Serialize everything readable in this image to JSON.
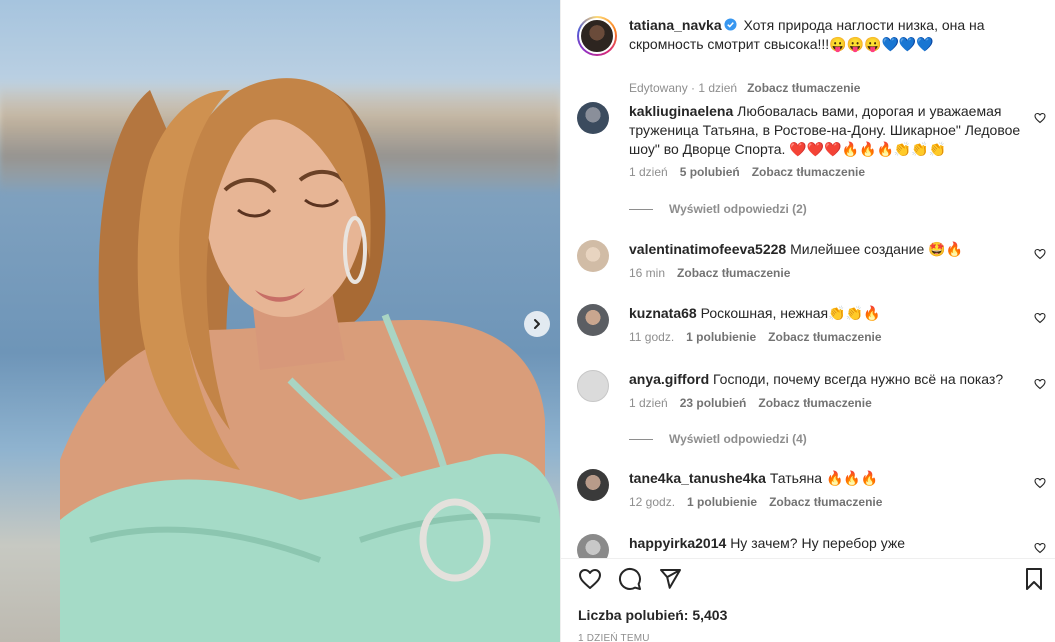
{
  "post": {
    "author": "tatiana_navka",
    "caption": "Хотя природа наглости низка, она на скромность смотрит свысока!!!😛😛😛💙💙💙",
    "edited_label": "Edytowany · 1 dzień",
    "translate_label": "Zobacz tłumaczenie"
  },
  "comments": [
    {
      "user": "kakliuginaelena",
      "text": "Любовалась вами, дорогая и уважаемая труженица Татьяна, в Ростове-на-Дону. Шикарное\" Ледовое шоу\" во Дворце Спорта. ❤️❤️❤️🔥🔥🔥👏👏👏",
      "time": "1 dzień",
      "likes": "5 polubień",
      "translate": "Zobacz tłumaczenie",
      "replies": "Wyświetl odpowiedzi (2)"
    },
    {
      "user": "valentinatimofeeva5228",
      "text": "Милейшее создание 🤩🔥",
      "time": "16 min",
      "translate": "Zobacz tłumaczenie"
    },
    {
      "user": "kuznata68",
      "text": "Роскошная, нежная👏👏🔥",
      "time": "11 godz.",
      "likes": "1 polubienie",
      "translate": "Zobacz tłumaczenie"
    },
    {
      "user": "anya.gifford",
      "text": "Господи, почему всегда нужно всё на показ?",
      "time": "1 dzień",
      "likes": "23 polubień",
      "translate": "Zobacz tłumaczenie",
      "replies": "Wyświetl odpowiedzi (4)"
    },
    {
      "user": "tane4ka_tanushe4ka",
      "text": "Татьяна 🔥🔥🔥",
      "time": "12 godz.",
      "likes": "1 polubienie",
      "translate": "Zobacz tłumaczenie"
    },
    {
      "user": "happyirka2014",
      "text": "Ну зачем? Ну перебор уже"
    }
  ],
  "footer": {
    "likes": "Liczba polubień: 5,403",
    "date": "1 DZIEŃ TEMU"
  },
  "icons": {
    "like": "heart-icon",
    "comment": "comment-icon",
    "share": "send-icon",
    "save": "bookmark-icon",
    "next": "chevron-right-icon"
  },
  "colors": {
    "verified": "#3897f0",
    "text": "#262626",
    "secondary": "#8e8e8e"
  }
}
